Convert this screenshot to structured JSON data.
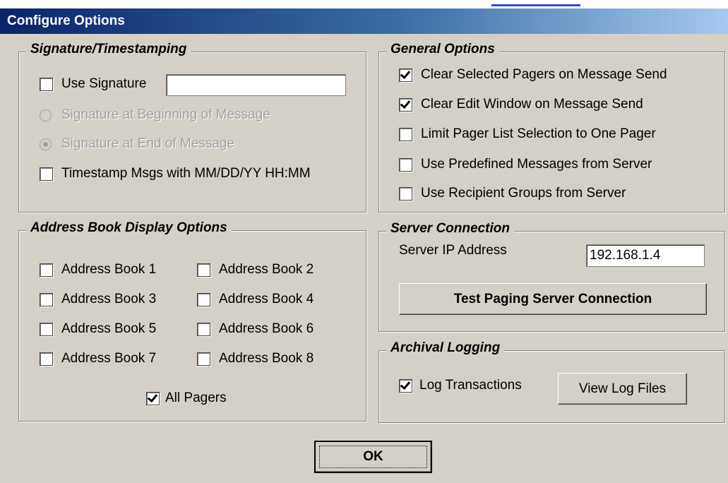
{
  "window": {
    "title": "Configure Options"
  },
  "signature_group": {
    "legend": "Signature/Timestamping",
    "use_signature": {
      "label": "Use Signature",
      "checked": false
    },
    "signature_text": "",
    "begin_option": {
      "label": "Signature at Beginning of Message",
      "selected": false,
      "enabled": false
    },
    "end_option": {
      "label": "Signature at End of Message",
      "selected": true,
      "enabled": false
    },
    "timestamp": {
      "label": "Timestamp Msgs with MM/DD/YY HH:MM",
      "checked": false
    }
  },
  "general_group": {
    "legend": "General Options",
    "options": [
      {
        "label": "Clear Selected Pagers on Message Send",
        "checked": true
      },
      {
        "label": "Clear Edit Window on Message Send",
        "checked": true
      },
      {
        "label": "Limit Pager List Selection to One Pager",
        "checked": false
      },
      {
        "label": "Use Predefined Messages from Server",
        "checked": false
      },
      {
        "label": "Use Recipient Groups from Server",
        "checked": false
      }
    ]
  },
  "address_group": {
    "legend": "Address Book Display Options",
    "books": [
      {
        "label": "Address Book 1",
        "checked": false
      },
      {
        "label": "Address Book 2",
        "checked": false
      },
      {
        "label": "Address Book 3",
        "checked": false
      },
      {
        "label": "Address Book 4",
        "checked": false
      },
      {
        "label": "Address Book 5",
        "checked": false
      },
      {
        "label": "Address Book 6",
        "checked": false
      },
      {
        "label": "Address Book 7",
        "checked": false
      },
      {
        "label": "Address Book 8",
        "checked": false
      }
    ],
    "all_pagers": {
      "label": "All Pagers",
      "checked": true
    }
  },
  "server_group": {
    "legend": "Server Connection",
    "ip_label": "Server IP Address",
    "ip_value": "192.168.1.4",
    "test_button": "Test Paging Server Connection"
  },
  "logging_group": {
    "legend": "Archival Logging",
    "log_transactions": {
      "label": "Log Transactions",
      "checked": true
    },
    "view_button": "View Log Files"
  },
  "ok_button": "OK"
}
